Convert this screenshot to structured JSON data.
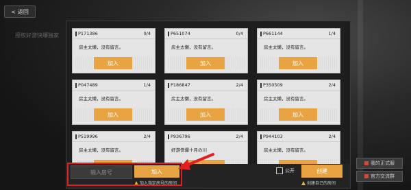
{
  "header": {
    "back_label": "返回"
  },
  "background": {
    "caption": "授权好游快爆独家"
  },
  "sidebar": [
    {
      "label": "我的正式服"
    },
    {
      "label": "官方交流群"
    }
  ],
  "rooms": [
    {
      "id": "P171386",
      "players": "0/4",
      "message": "房主太懒，没有留言。",
      "join_label": "加入"
    },
    {
      "id": "P651074",
      "players": "0/4",
      "message": "房主太懒，没有留言。",
      "join_label": "加入"
    },
    {
      "id": "P661144",
      "players": "1/4",
      "message": "房主太懒，没有留言。",
      "join_label": "加入"
    },
    {
      "id": "P047489",
      "players": "1/4",
      "message": "房主太懒，没有留言。",
      "join_label": "加入"
    },
    {
      "id": "P186847",
      "players": "2/4",
      "message": "房主太懒，没有留言。",
      "join_label": "加入"
    },
    {
      "id": "P350509",
      "players": "2/4",
      "message": "房主太懒，没有留言。",
      "join_label": "加入"
    },
    {
      "id": "P519996",
      "players": "2/4",
      "message": "房主太懒，没有留言。",
      "join_label": "加入"
    },
    {
      "id": "P936796",
      "players": "2/4",
      "message": "好游快爆十月の川",
      "join_label": "加入"
    },
    {
      "id": "P944103",
      "players": "2/4",
      "message": "房主太懒，没有留言。",
      "join_label": "加入"
    }
  ],
  "footer": {
    "room_input_placeholder": "输入房号",
    "join_label": "加入",
    "join_hint": "加入指定房号的房间",
    "public_label": "公开",
    "create_label": "创建",
    "create_hint": "创建自己的房间"
  },
  "colors": {
    "accent": "#e8a343",
    "highlight": "#e02020"
  }
}
